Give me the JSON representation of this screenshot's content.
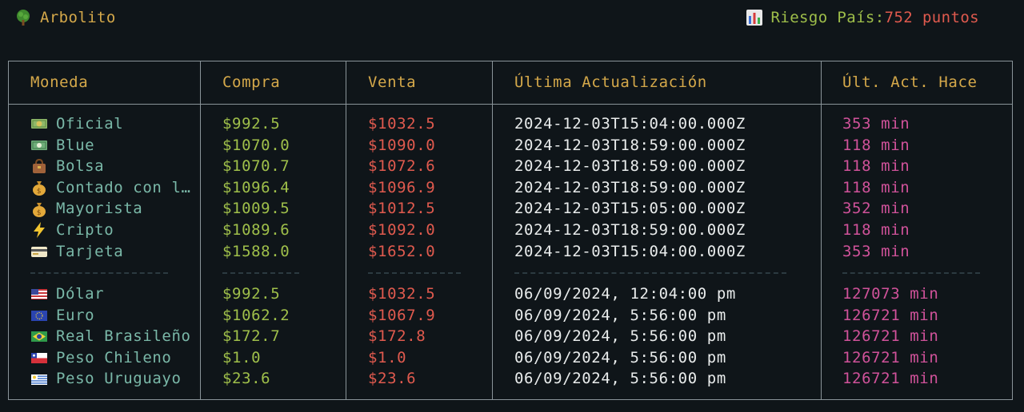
{
  "app": {
    "title": "Arbolito",
    "icon": "tree-icon"
  },
  "risk": {
    "icon": "bar-chart-icon",
    "label": "Riesgo País: ",
    "value": "752 puntos"
  },
  "table": {
    "headers": {
      "currency": "Moneda",
      "buy": "Compra",
      "sell": "Venta",
      "updated": "Última Actualización",
      "ago": "Últ. Act. Hace"
    },
    "dollars": [
      {
        "icon": "money-bill-icon",
        "name": "Oficial",
        "buy": "$992.5",
        "sell": "$1032.5",
        "updated": "2024-12-03T15:04:00.000Z",
        "ago": "353 min"
      },
      {
        "icon": "dollar-banknote-icon",
        "name": "Blue",
        "buy": "$1070.0",
        "sell": "$1090.0",
        "updated": "2024-12-03T18:59:00.000Z",
        "ago": "118 min"
      },
      {
        "icon": "handbag-icon",
        "name": "Bolsa",
        "buy": "$1070.7",
        "sell": "$1072.6",
        "updated": "2024-12-03T18:59:00.000Z",
        "ago": "118 min"
      },
      {
        "icon": "money-bag-icon",
        "name": "Contado con l…",
        "buy": "$1096.4",
        "sell": "$1096.9",
        "updated": "2024-12-03T18:59:00.000Z",
        "ago": "118 min"
      },
      {
        "icon": "money-bag-icon",
        "name": "Mayorista",
        "buy": "$1009.5",
        "sell": "$1012.5",
        "updated": "2024-12-03T15:05:00.000Z",
        "ago": "352 min"
      },
      {
        "icon": "lightning-icon",
        "name": "Cripto",
        "buy": "$1089.6",
        "sell": "$1092.0",
        "updated": "2024-12-03T18:59:00.000Z",
        "ago": "118 min"
      },
      {
        "icon": "credit-card-icon",
        "name": "Tarjeta",
        "buy": "$1588.0",
        "sell": "$1652.0",
        "updated": "2024-12-03T15:04:00.000Z",
        "ago": "353 min"
      }
    ],
    "currencies": [
      {
        "icon": "flag-us-icon",
        "name": "Dólar",
        "buy": "$992.5",
        "sell": "$1032.5",
        "updated": "06/09/2024, 12:04:00 pm",
        "ago": "127073 min"
      },
      {
        "icon": "flag-eu-icon",
        "name": "Euro",
        "buy": "$1062.2",
        "sell": "$1067.9",
        "updated": "06/09/2024, 5:56:00 pm",
        "ago": "126721 min"
      },
      {
        "icon": "flag-br-icon",
        "name": "Real Brasileño",
        "buy": "$172.7",
        "sell": "$172.8",
        "updated": "06/09/2024, 5:56:00 pm",
        "ago": "126721 min"
      },
      {
        "icon": "flag-cl-icon",
        "name": "Peso Chileno",
        "buy": "$1.0",
        "sell": "$1.0",
        "updated": "06/09/2024, 5:56:00 pm",
        "ago": "126721 min"
      },
      {
        "icon": "flag-uy-icon",
        "name": "Peso Uruguayo",
        "buy": "$23.6",
        "sell": "$23.6",
        "updated": "06/09/2024, 5:56:00 pm",
        "ago": "126721 min"
      }
    ]
  },
  "colors": {
    "background": "#0f1519",
    "header_text": "#d4a84a",
    "name_text": "#7ab8a8",
    "buy_text": "#9fbf4a",
    "sell_text": "#e05a4e",
    "date_text": "#e9ecec",
    "ago_text": "#d0529a",
    "border": "#8a9499"
  }
}
